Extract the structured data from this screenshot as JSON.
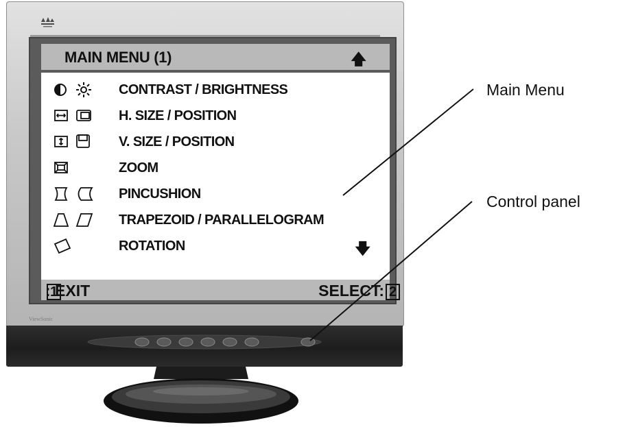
{
  "osd": {
    "title": "MAIN MENU (1)",
    "items": [
      {
        "label": "CONTRAST / BRIGHTNESS",
        "icons": [
          "contrast-icon",
          "brightness-icon"
        ]
      },
      {
        "label": "H. SIZE / POSITION",
        "icons": [
          "h-size-icon",
          "h-position-icon"
        ]
      },
      {
        "label": "V. SIZE / POSITION",
        "icons": [
          "v-size-icon",
          "v-position-icon"
        ]
      },
      {
        "label": "ZOOM",
        "icons": [
          "zoom-icon"
        ]
      },
      {
        "label": "PINCUSHION",
        "icons": [
          "pincushion-icon",
          "pin-balance-icon"
        ]
      },
      {
        "label": "TRAPEZOID / PARALLELOGRAM",
        "icons": [
          "trapezoid-icon",
          "parallelogram-icon"
        ]
      },
      {
        "label": "ROTATION",
        "icons": [
          "rotation-icon"
        ]
      }
    ],
    "footer": {
      "exit_key": "1",
      "exit_text": ": EXIT",
      "select_text": "SELECT:",
      "select_key": "2"
    }
  },
  "monitor": {
    "brand": "ViewSonic",
    "button_count": 7
  },
  "callouts": {
    "main_menu": "Main Menu",
    "control_panel": "Control panel"
  }
}
